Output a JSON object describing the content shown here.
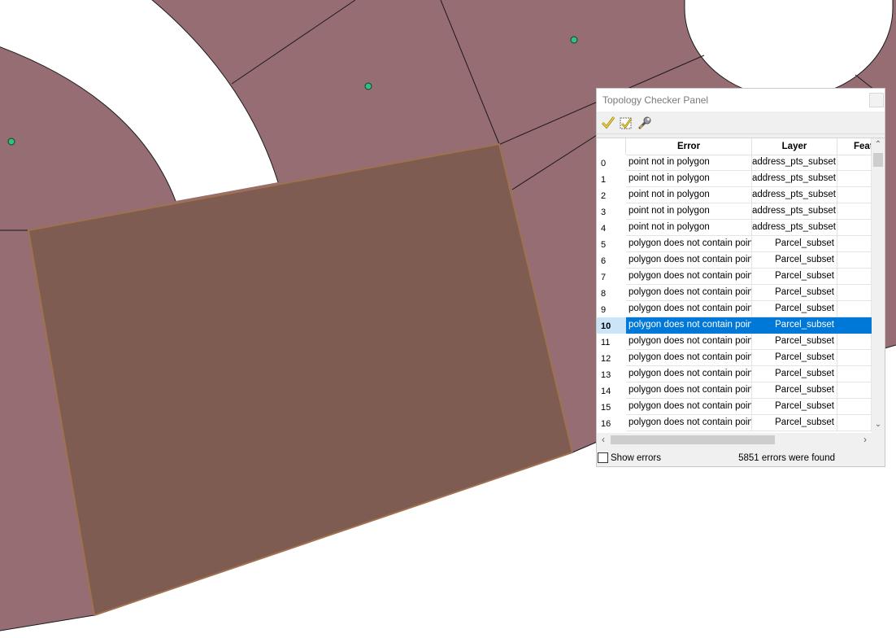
{
  "panel": {
    "title": "Topology Checker Panel",
    "toolbar": {
      "validate_all_icon": "checkmark-icon",
      "validate_extent_icon": "validate-extent-icon",
      "configure_icon": "wrench-icon"
    },
    "columns": [
      "Error",
      "Layer",
      "Feat"
    ],
    "rows": [
      {
        "n": "0",
        "error": "point not in polygon",
        "layer": "address_pts_subset"
      },
      {
        "n": "1",
        "error": "point not in polygon",
        "layer": "address_pts_subset"
      },
      {
        "n": "2",
        "error": "point not in polygon",
        "layer": "address_pts_subset"
      },
      {
        "n": "3",
        "error": "point not in polygon",
        "layer": "address_pts_subset"
      },
      {
        "n": "4",
        "error": "point not in polygon",
        "layer": "address_pts_subset"
      },
      {
        "n": "5",
        "error": "polygon does not contain point",
        "layer": "Parcel_subset"
      },
      {
        "n": "6",
        "error": "polygon does not contain point",
        "layer": "Parcel_subset"
      },
      {
        "n": "7",
        "error": "polygon does not contain point",
        "layer": "Parcel_subset"
      },
      {
        "n": "8",
        "error": "polygon does not contain point",
        "layer": "Parcel_subset"
      },
      {
        "n": "9",
        "error": "polygon does not contain point",
        "layer": "Parcel_subset"
      },
      {
        "n": "10",
        "error": "polygon does not contain point",
        "layer": "Parcel_subset",
        "selected": true
      },
      {
        "n": "11",
        "error": "polygon does not contain point",
        "layer": "Parcel_subset"
      },
      {
        "n": "12",
        "error": "polygon does not contain point",
        "layer": "Parcel_subset"
      },
      {
        "n": "13",
        "error": "polygon does not contain point",
        "layer": "Parcel_subset"
      },
      {
        "n": "14",
        "error": "polygon does not contain point",
        "layer": "Parcel_subset"
      },
      {
        "n": "15",
        "error": "polygon does not contain point",
        "layer": "Parcel_subset"
      },
      {
        "n": "16",
        "error": "polygon does not contain point",
        "layer": "Parcel_subset"
      }
    ],
    "footer": {
      "show_errors_label": "Show errors",
      "show_errors_checked": false,
      "count_text": "5851 errors were found"
    }
  },
  "colors": {
    "parcel_fill": "#976d74",
    "highlight_fill": "#7f5c52",
    "highlight_border": "#a0714f",
    "point_fill": "#2ec27e",
    "selection": "#0078d7"
  }
}
